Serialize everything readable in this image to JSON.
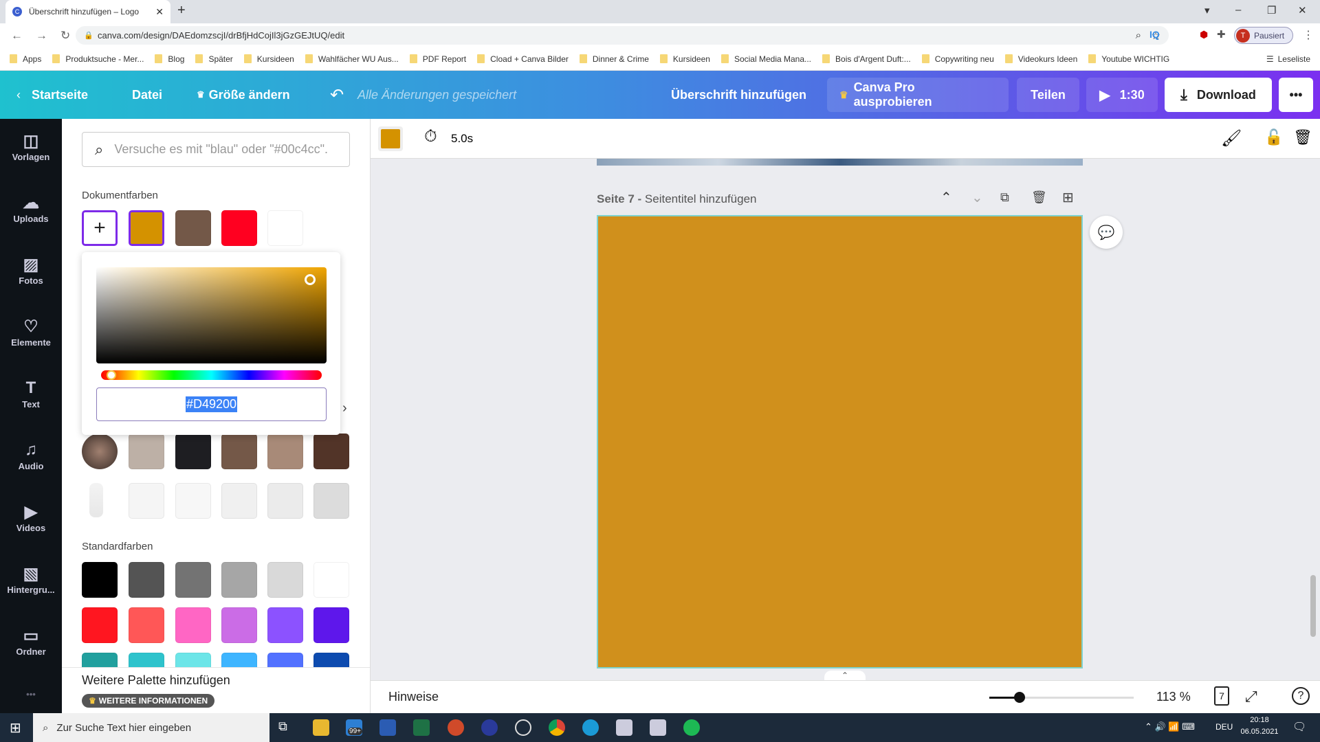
{
  "browser": {
    "tab_title": "Überschrift hinzufügen – Logo",
    "url": "canva.com/design/DAEdomzscjI/drBfjHdCojIl3jGzGEJtUQ/edit",
    "profile": "Pausiert",
    "profile_initial": "T",
    "bookmarks": [
      "Apps",
      "Produktsuche - Mer...",
      "Blog",
      "Später",
      "Kursideen",
      "Wahlfächer WU Aus...",
      "PDF Report",
      "Cload + Canva Bilder",
      "Dinner & Crime",
      "Kursideen",
      "Social Media Mana...",
      "Bois d'Argent Duft:...",
      "Copywriting neu",
      "Videokurs Ideen",
      "Youtube WICHTIG"
    ],
    "reading_list": "Leseliste"
  },
  "header": {
    "home": "Startseite",
    "file": "Datei",
    "resize": "Größe ändern",
    "saved_status": "Alle Änderungen gespeichert",
    "title": "Überschrift hinzufügen",
    "pro": "Canva Pro ausprobieren",
    "share": "Teilen",
    "play_duration": "1:30",
    "download": "Download",
    "more": "•••"
  },
  "rail": [
    {
      "label": "Vorlagen",
      "icon": "templates-icon",
      "glyph": "◫"
    },
    {
      "label": "Uploads",
      "icon": "cloud-upload-icon",
      "glyph": "☁"
    },
    {
      "label": "Fotos",
      "icon": "photo-icon",
      "glyph": "▨"
    },
    {
      "label": "Elemente",
      "icon": "shapes-icon",
      "glyph": "♡"
    },
    {
      "label": "Text",
      "icon": "text-icon",
      "glyph": "T"
    },
    {
      "label": "Audio",
      "icon": "music-icon",
      "glyph": "♫"
    },
    {
      "label": "Videos",
      "icon": "video-icon",
      "glyph": "▶"
    },
    {
      "label": "Hintergru...",
      "icon": "background-icon",
      "glyph": "▧"
    },
    {
      "label": "Ordner",
      "icon": "folder-icon",
      "glyph": "▭"
    }
  ],
  "panel": {
    "search_placeholder": "Versuche es mit \"blau\" oder \"#00c4cc\".",
    "document_colors_label": "Dokumentfarben",
    "document_colors": [
      "#D49200",
      "#735848",
      "#FF0020",
      "#FFFFFF"
    ],
    "picker": {
      "hex": "#D49200"
    },
    "photo_colors_1": [
      "#BDB0A6",
      "#1E1E22",
      "#745848",
      "#A88A78",
      "#523428"
    ],
    "photo_colors_2": [
      "#F5F5F5",
      "#F7F7F7",
      "#F0F0F0",
      "#EBEBEB",
      "#DCDCDC"
    ],
    "standard_label": "Standardfarben",
    "standard_colors": [
      [
        "#000000",
        "#545454",
        "#737373",
        "#A6A6A6",
        "#D9D9D9",
        "#FFFFFF"
      ],
      [
        "#FF1620",
        "#FF5757",
        "#FF66C4",
        "#CB6CE6",
        "#8C52FF",
        "#5E17EB"
      ],
      [
        "#21A09E",
        "#2EC3CC",
        "#6CE5E8",
        "#3EB5FF",
        "#5271FF",
        "#0D4BAF"
      ]
    ],
    "add_palette": "Weitere Palette hinzufügen",
    "more_info": "WEITERE INFORMATIONEN"
  },
  "toolbar": {
    "duration": "5.0s",
    "color": "#D49200"
  },
  "canvas": {
    "page_title_prefix": "Seite 7 - ",
    "page_title": "Seitentitel hinzufügen",
    "page_color": "#D0901C"
  },
  "bottom": {
    "notes": "Hinweise",
    "zoom": "113 %",
    "zoom_percent": 113,
    "page_count": "7"
  },
  "taskbar": {
    "search": "Zur Suche Text hier eingeben",
    "mail_badge": "99+",
    "lang": "DEU",
    "time": "20:18",
    "date": "06.05.2021"
  }
}
